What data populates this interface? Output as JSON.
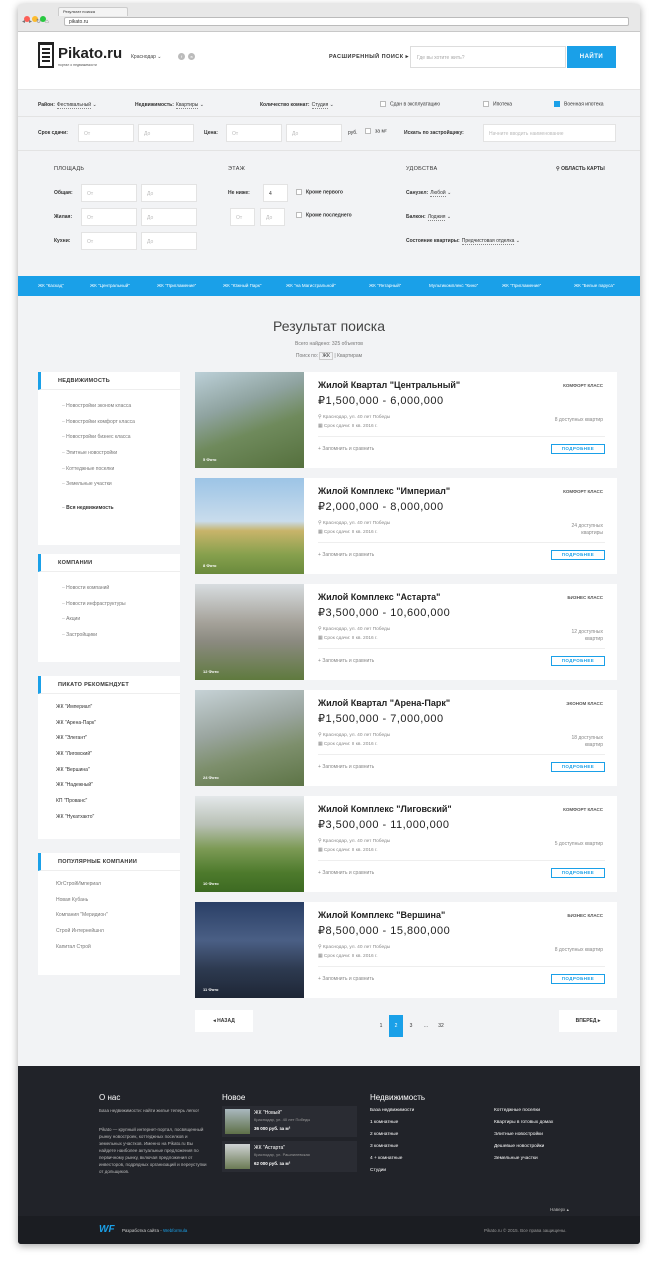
{
  "browser": {
    "tab": "Результат поиска",
    "url": "pikato.ru"
  },
  "header": {
    "logo": "Pikato.ru",
    "tagline": "портал о недвижимости",
    "city": "Краснодар",
    "advanced": "РАСШИРЕННЫЙ ПОИСК",
    "search_placeholder": "Где вы хотите жить?",
    "search_btn": "НАЙТИ"
  },
  "filters": {
    "district_label": "Район:",
    "district": "Фестивальный",
    "estate_label": "Недвижимость:",
    "estate": "Квартиры",
    "rooms_label": "Количество комнат:",
    "rooms": "Студия",
    "chk1": "Сдан в эксплуатацию",
    "chk2": "Ипотека",
    "chk3": "Военная ипотека",
    "term_label": "Срок сдачи:",
    "from": "От",
    "to": "До",
    "price_label": "Цена:",
    "rub": "руб.",
    "perm": "за м²",
    "dev_label": "Искать по застройщику:",
    "dev_placeholder": "Начните вводить наименование",
    "area_h": "ПЛОЩАДЬ",
    "total": "Общая:",
    "living": "Жилая:",
    "kitchen": "Кухни:",
    "floor_h": "ЭТАЖ",
    "not_below": "Не ниже:",
    "floor_val": "4",
    "not_first": "Кроме первого",
    "not_last": "Кроме последнего",
    "amen_h": "УДОБСТВА",
    "map": "ОБЛАСТЬ КАРТЫ",
    "bath_label": "Санузел:",
    "bath": "Любой",
    "balcony_label": "Балкон:",
    "balcony": "Лоджия",
    "state_label": "Состояние квартиры:",
    "state": "Предчистовая отделка"
  },
  "categories": [
    "ЖК \"Каскад\"",
    "ЖК \"Центральный\"",
    "ЖК \"Пригламение\"",
    "ЖК \"Южный Парк\"",
    "ЖК \"на Магистральной\"",
    "ЖК \"Янтарный\"",
    "Мультикомплекс \"Кино\"",
    "ЖК \"Пригламение\"",
    "ЖК \"Белые паруса\""
  ],
  "results": {
    "title": "Результат поиска",
    "count": "Всего найдено: 325 объектов",
    "by": "Поиск по:",
    "by_active": "ЖК",
    "by_other": "Квартирам"
  },
  "sidebar": {
    "estate": {
      "title": "НЕДВИЖИМОСТЬ",
      "items": [
        "Новостройки эконом класса",
        "Новостройки комфорт класса",
        "Новостройки бизнес класса",
        "Элитные новостройки",
        "Коттеджные поселки",
        "Земельные участки"
      ],
      "all": "Вся недвижимость"
    },
    "companies": {
      "title": "КОМПАНИИ",
      "items": [
        "Новости компаний",
        "Новости инфраструктуры",
        "Акции",
        "Застройщики"
      ]
    },
    "recommend": {
      "title": "ПИКАТО РЕКОМЕНДУЕТ",
      "items": [
        "ЖК \"Империал\"",
        "ЖК \"Арена-Парк\"",
        "ЖК \"Элегант\"",
        "ЖК \"Лиговский\"",
        "ЖК \"Вершина\"",
        "ЖК \"Надежный\"",
        "КП \"Прованс\"",
        "ЖК \"Нукатхакто\""
      ]
    },
    "popular": {
      "title": "ПОПУЛЯРНЫЕ КОМПАНИИ",
      "items": [
        "ЮгСтройИмпериал",
        "Новая Кубань",
        "Компания \"Меридион\"",
        "Строй Интернейшнл",
        "Капитал Строй"
      ]
    }
  },
  "cards": [
    {
      "photos": "5 Фото",
      "title": "Жилой Квартал \"Центральный\"",
      "price": "₽1,500,000 - 6,000,000",
      "class": "КОМФОРТ КЛАСС",
      "addr": "Краснодар, ул. 40 лет Победы",
      "date": "Срок сдачи: II кв. 2016 г.",
      "flats": "8 доступных квартир",
      "save": "Запомнить и сравнить",
      "more": "ПОДРОБНЕЕ"
    },
    {
      "photos": "8 Фото",
      "title": "Жилой Комплекс \"Империал\"",
      "price": "₽2,000,000 - 8,000,000",
      "class": "КОМФОРТ КЛАСС",
      "addr": "Краснодар, ул. 40 лет Победы",
      "date": "Срок сдачи: II кв. 2016 г.",
      "flats": "24 доступных квартиры",
      "save": "Запомнить и сравнить",
      "more": "ПОДРОБНЕЕ"
    },
    {
      "photos": "12 Фото",
      "title": "Жилой Комплекс \"Астарта\"",
      "price": "₽3,500,000 - 10,600,000",
      "class": "БИЗНЕС КЛАСС",
      "addr": "Краснодар, ул. 40 лет Победы",
      "date": "Срок сдачи: II кв. 2016 г.",
      "flats": "12 доступных квартир",
      "save": "Запомнить и сравнить",
      "more": "ПОДРОБНЕЕ"
    },
    {
      "photos": "24 Фото",
      "title": "Жилой Квартал \"Арена-Парк\"",
      "price": "₽1,500,000 - 7,000,000",
      "class": "ЭКОНОМ КЛАСС",
      "addr": "Краснодар, ул. 40 лет Победы",
      "date": "Срок сдачи: II кв. 2016 г.",
      "flats": "18 доступных квартир",
      "save": "Запомнить и сравнить",
      "more": "ПОДРОБНЕЕ"
    },
    {
      "photos": "10 Фото",
      "title": "Жилой Комплекс \"Лиговский\"",
      "price": "₽3,500,000 - 11,000,000",
      "class": "КОМФОРТ КЛАСС",
      "addr": "Краснодар, ул. 40 лет Победы",
      "date": "Срок сдачи: II кв. 2016 г.",
      "flats": "5 доступных квартир",
      "save": "Запомнить и сравнить",
      "more": "ПОДРОБНЕЕ"
    },
    {
      "photos": "11 Фото",
      "title": "Жилой Комплекс \"Вершина\"",
      "price": "₽8,500,000 - 15,800,000",
      "class": "БИЗНЕС КЛАСС",
      "addr": "Краснодар, ул. 40 лет Победы",
      "date": "Срок сдачи: II кв. 2016 г.",
      "flats": "8 доступных квартир",
      "save": "Запомнить и сравнить",
      "more": "ПОДРОБНЕЕ"
    }
  ],
  "pagination": {
    "prev": "◂ НАЗАД",
    "next": "ВПЕРЕД ▸",
    "pages": [
      "1",
      "2",
      "3",
      "...",
      "32"
    ]
  },
  "footer": {
    "about_h": "О нас",
    "about_lead": "База недвижимости: найти жилье теперь легко!",
    "about_text": "Pikato — крупный интернет-портал, посвященный рынку новостроек, коттеджных поселков и земельных участков. Именно на Pikato.ru Вы найдете наиболее актуальные предложения по первичному рынку, включая предложения от инвесторов, подрядных организаций и переуступки от дольщиков.",
    "news_h": "Новое",
    "news": [
      {
        "t": "ЖК \"Новый\"",
        "a": "Краснодар, ул. 40 лет Победы",
        "p": "36 000 руб. за м²"
      },
      {
        "t": "ЖК \"Астарта\"",
        "a": "Краснодар, ул. Рашпилевская",
        "p": "62 000 руб. за м²"
      }
    ],
    "estate_h": "Недвижимость",
    "col1": [
      "База недвижимости",
      "1 комнатные",
      "2 комнатные",
      "3 комнатные",
      "4 + комнатные",
      "Студии"
    ],
    "col2": [
      "Коттеджные поселки",
      "Квартиры в готовых домах",
      "Элитные новостройки",
      "Дешевые новостройки",
      "Земельные участки"
    ],
    "up": "Наверх",
    "dev": "Разработка сайта -",
    "dev_link": "Webformula",
    "copy": "Pikato.ru © 2015. Все права защищены."
  }
}
